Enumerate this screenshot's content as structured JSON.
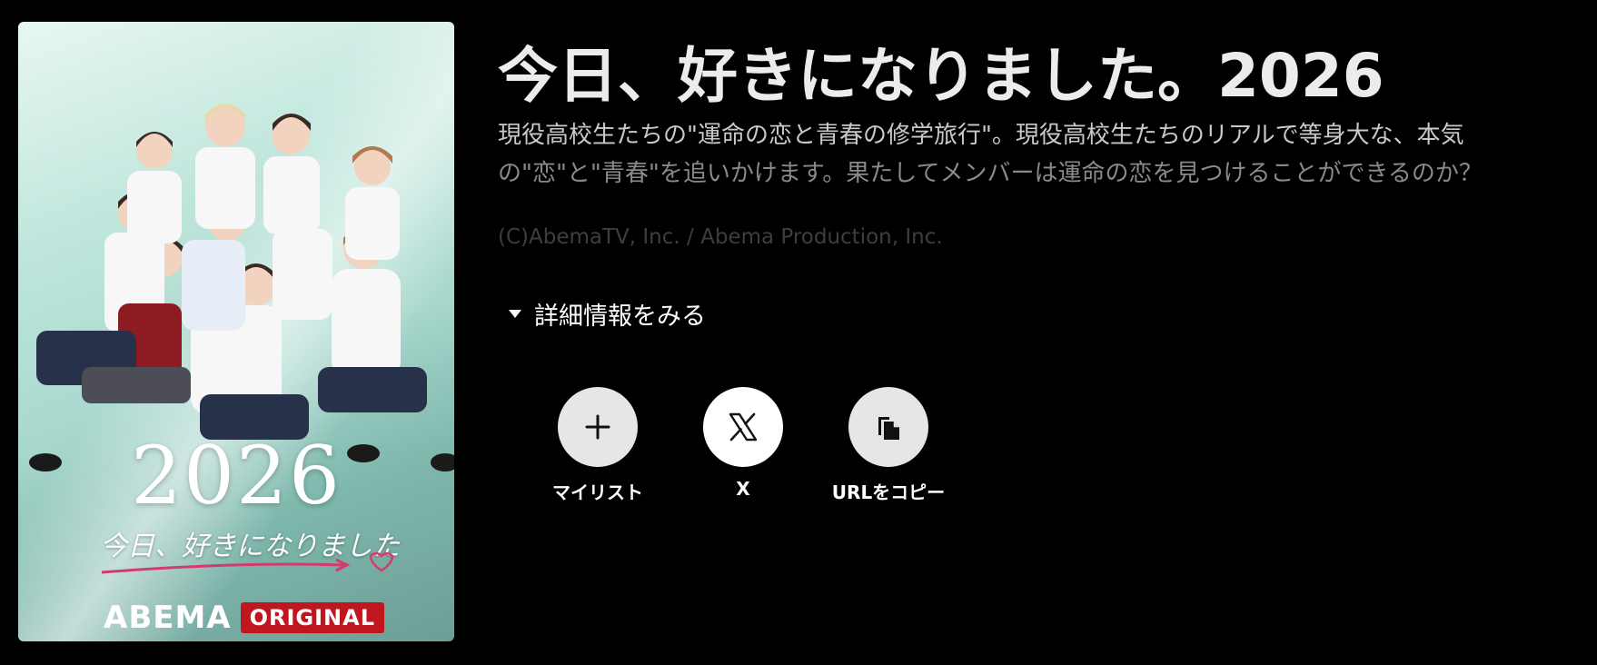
{
  "poster": {
    "year": "2026",
    "script_title": "今日、好きになりました",
    "brand": "ABEMA",
    "brand_tag": "ORIGINAL"
  },
  "program": {
    "title": "今日、好きになりました。2026",
    "description_line1": "現役高校生たちの\"運命の恋と青春の修学旅行\"。現役高校生たちのリアルで等身大な、本気",
    "description_line2": "の\"恋\"と\"青春\"を追いかけます。果たしてメンバーは運命の恋を見つけることができるのか？",
    "copyright": "(C)AbemaTV, Inc. / Abema Production, Inc."
  },
  "details": {
    "label": "詳細情報をみる",
    "icon": "triangle-down-icon"
  },
  "actions": [
    {
      "label": "マイリスト",
      "icon": "plus-icon"
    },
    {
      "label": "X",
      "icon": "x-logo-icon"
    },
    {
      "label": "URLをコピー",
      "icon": "copy-icon"
    }
  ],
  "colors": {
    "background": "#000000",
    "brand_red": "#c0161e",
    "button_gray": "#e6e6e6"
  }
}
